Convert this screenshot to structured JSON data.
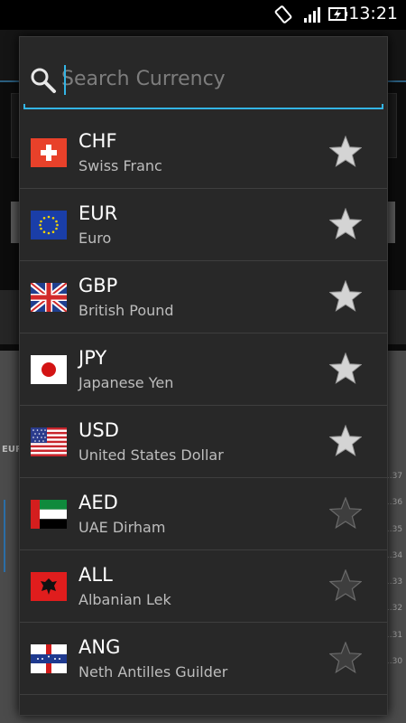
{
  "status_bar": {
    "time": "13:21"
  },
  "background": {
    "chart_label": "EUR",
    "ticks": [
      "1.37",
      "1.36",
      "1.35",
      "1.34",
      "1.33",
      "1.32",
      "1.31",
      "1.30"
    ]
  },
  "search": {
    "placeholder": "Search Currency",
    "value": ""
  },
  "currencies": [
    {
      "code": "CHF",
      "name": "Swiss Franc",
      "flag": "switzerland-flag-icon",
      "favorite": true
    },
    {
      "code": "EUR",
      "name": "Euro",
      "flag": "eu-flag-icon",
      "favorite": true
    },
    {
      "code": "GBP",
      "name": "British Pound",
      "flag": "uk-flag-icon",
      "favorite": true
    },
    {
      "code": "JPY",
      "name": "Japanese Yen",
      "flag": "japan-flag-icon",
      "favorite": true
    },
    {
      "code": "USD",
      "name": "United States Dollar",
      "flag": "usa-flag-icon",
      "favorite": true
    },
    {
      "code": "AED",
      "name": "UAE Dirham",
      "flag": "uae-flag-icon",
      "favorite": false
    },
    {
      "code": "ALL",
      "name": "Albanian Lek",
      "flag": "albania-flag-icon",
      "favorite": false
    },
    {
      "code": "ANG",
      "name": "Neth Antilles Guilder",
      "flag": "netherlands-antilles-flag-icon",
      "favorite": false
    }
  ],
  "colors": {
    "accent": "#33b5e5",
    "star_on": "#d4d4d4",
    "star_off": "#4a4a4a"
  }
}
